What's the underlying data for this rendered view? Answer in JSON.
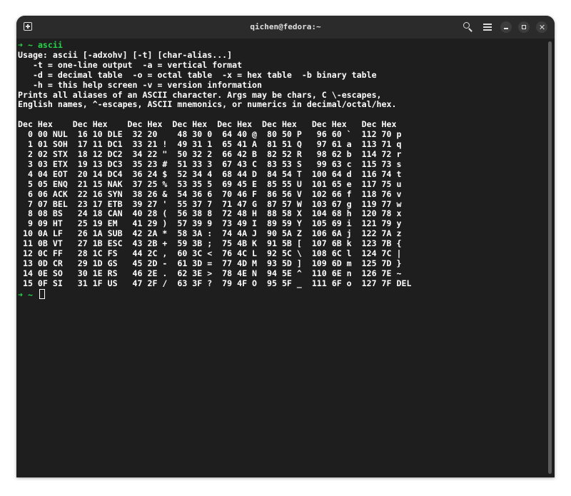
{
  "window": {
    "title": "qichen@fedora:~"
  },
  "prompt": {
    "arrow": "➜",
    "dir": "~",
    "command": "ascii"
  },
  "output": {
    "usage_lines": [
      "Usage: ascii [-adxohv] [-t] [char-alias...]",
      "   -t = one-line output  -a = vertical format",
      "   -d = decimal table  -o = octal table  -x = hex table  -b binary table",
      "   -h = this help screen -v = version information",
      "Prints all aliases of an ASCII character. Args may be chars, C \\-escapes,",
      "English names, ^-escapes, ASCII mnemonics, or numerics in decimal/octal/hex."
    ],
    "table_lines": [
      "Dec Hex    Dec Hex    Dec Hex  Dec Hex  Dec Hex  Dec Hex   Dec Hex   Dec Hex",
      "  0 00 NUL  16 10 DLE  32 20    48 30 0  64 40 @  80 50 P   96 60 `  112 70 p",
      "  1 01 SOH  17 11 DC1  33 21 !  49 31 1  65 41 A  81 51 Q   97 61 a  113 71 q",
      "  2 02 STX  18 12 DC2  34 22 \"  50 32 2  66 42 B  82 52 R   98 62 b  114 72 r",
      "  3 03 ETX  19 13 DC3  35 23 #  51 33 3  67 43 C  83 53 S   99 63 c  115 73 s",
      "  4 04 EOT  20 14 DC4  36 24 $  52 34 4  68 44 D  84 54 T  100 64 d  116 74 t",
      "  5 05 ENQ  21 15 NAK  37 25 %  53 35 5  69 45 E  85 55 U  101 65 e  117 75 u",
      "  6 06 ACK  22 16 SYN  38 26 &  54 36 6  70 46 F  86 56 V  102 66 f  118 76 v",
      "  7 07 BEL  23 17 ETB  39 27 '  55 37 7  71 47 G  87 57 W  103 67 g  119 77 w",
      "  8 08 BS   24 18 CAN  40 28 (  56 38 8  72 48 H  88 58 X  104 68 h  120 78 x",
      "  9 09 HT   25 19 EM   41 29 )  57 39 9  73 49 I  89 59 Y  105 69 i  121 79 y",
      " 10 0A LF   26 1A SUB  42 2A *  58 3A :  74 4A J  90 5A Z  106 6A j  122 7A z",
      " 11 0B VT   27 1B ESC  43 2B +  59 3B ;  75 4B K  91 5B [  107 6B k  123 7B {",
      " 12 0C FF   28 1C FS   44 2C ,  60 3C <  76 4C L  92 5C \\  108 6C l  124 7C |",
      " 13 0D CR   29 1D GS   45 2D -  61 3D =  77 4D M  93 5D ]  109 6D m  125 7D }",
      " 14 0E SO   30 1E RS   46 2E .  62 3E >  78 4E N  94 5E ^  110 6E n  126 7E ~",
      " 15 0F SI   31 1F US   47 2F /  63 3F ?  79 4F O  95 5F _  111 6F o  127 7F DEL"
    ]
  },
  "icons": {
    "new_tab": "new-tab-icon",
    "search": "search-icon",
    "menu": "hamburger-menu-icon",
    "minimize": "minimize-icon",
    "maximize": "maximize-icon",
    "close": "close-icon"
  },
  "colors": {
    "background": "#1e1e1e",
    "titlebar": "#2b2b2b",
    "prompt_green": "#26d64a",
    "text": "#ffffff"
  }
}
